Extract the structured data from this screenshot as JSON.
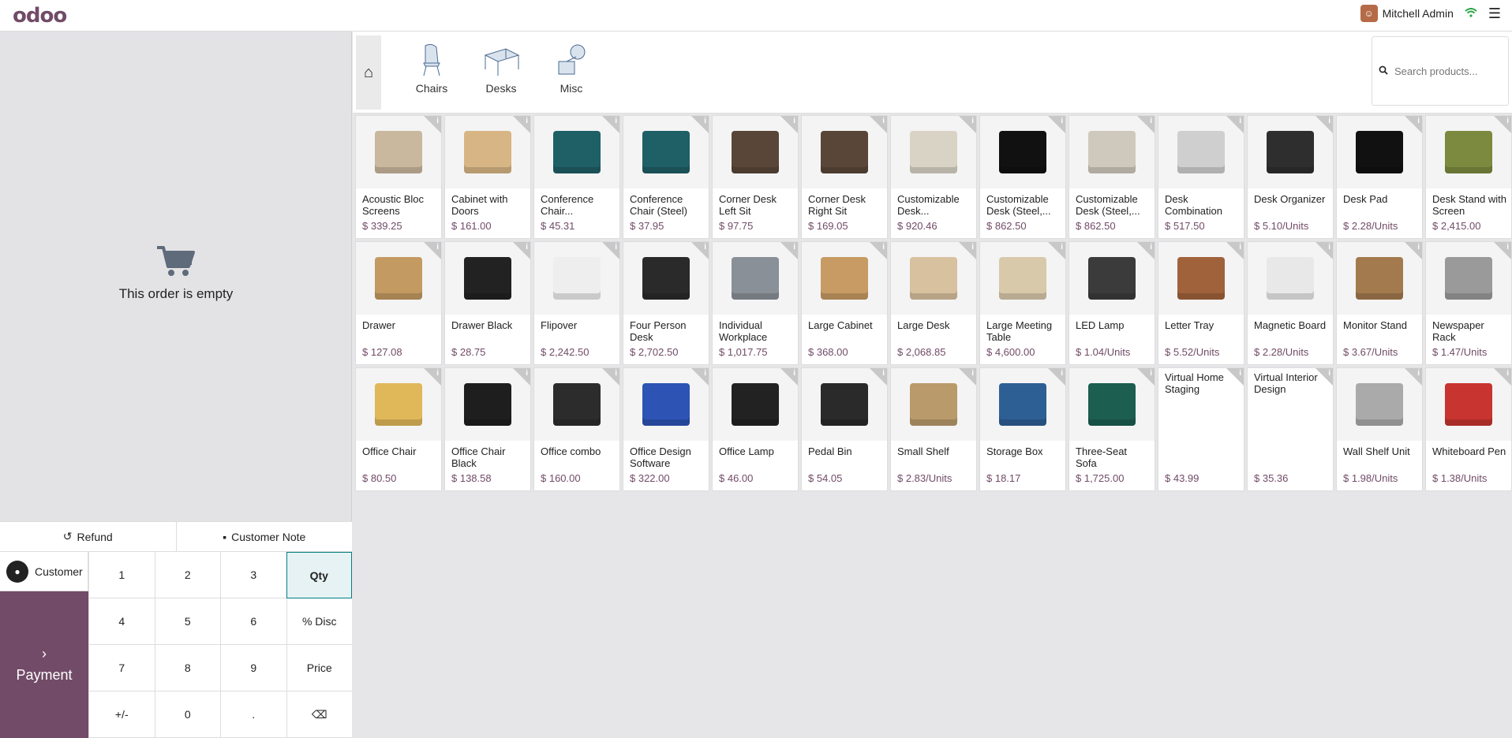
{
  "topbar": {
    "logo": "odoo",
    "user_name": "Mitchell Admin",
    "icons": {
      "wifi": "wifi-icon",
      "menu": "hamburger-menu-icon"
    }
  },
  "order": {
    "empty_text": "This order is empty"
  },
  "actions": {
    "refund": "Refund",
    "customer_note": "Customer Note"
  },
  "pad": {
    "customer": "Customer",
    "payment": "Payment",
    "keys": [
      "1",
      "2",
      "3",
      "Qty",
      "4",
      "5",
      "6",
      "% Disc",
      "7",
      "8",
      "9",
      "Price",
      "+/-",
      "0",
      ".",
      "⌫"
    ]
  },
  "categories": [
    {
      "label": "Chairs",
      "icon": "chair-icon"
    },
    {
      "label": "Desks",
      "icon": "desk-icon"
    },
    {
      "label": "Misc",
      "icon": "misc-icon"
    }
  ],
  "search": {
    "placeholder": "Search products..."
  },
  "products": [
    {
      "name": "Acoustic Bloc Screens",
      "price": "$ 339.25",
      "color": "#c9b79e"
    },
    {
      "name": "Cabinet with Doors",
      "price": "$ 161.00",
      "color": "#d8b584"
    },
    {
      "name": "Conference Chair...",
      "price": "$ 45.31",
      "color": "#1f5f66"
    },
    {
      "name": "Conference Chair (Steel)",
      "price": "$ 37.95",
      "color": "#1f5f66"
    },
    {
      "name": "Corner Desk Left Sit",
      "price": "$ 97.75",
      "color": "#5a4638"
    },
    {
      "name": "Corner Desk Right Sit",
      "price": "$ 169.05",
      "color": "#5a4638"
    },
    {
      "name": "Customizable Desk...",
      "price": "$ 920.46",
      "color": "#d9d3c6"
    },
    {
      "name": "Customizable Desk (Steel,...",
      "price": "$ 862.50",
      "color": "#111111"
    },
    {
      "name": "Customizable Desk (Steel,...",
      "price": "$ 862.50",
      "color": "#cfc9bd"
    },
    {
      "name": "Desk Combination",
      "price": "$ 517.50",
      "color": "#cfcfcf"
    },
    {
      "name": "Desk Organizer",
      "price": "$ 5.10/Units",
      "color": "#2e2e2e"
    },
    {
      "name": "Desk Pad",
      "price": "$ 2.28/Units",
      "color": "#111111"
    },
    {
      "name": "Desk Stand with Screen",
      "price": "$ 2,415.00",
      "color": "#7b8a3e"
    },
    {
      "name": "Drawer",
      "price": "$ 127.08",
      "color": "#c39a62"
    },
    {
      "name": "Drawer Black",
      "price": "$ 28.75",
      "color": "#222222"
    },
    {
      "name": "Flipover",
      "price": "$ 2,242.50",
      "color": "#eeeeee"
    },
    {
      "name": "Four Person Desk",
      "price": "$ 2,702.50",
      "color": "#2a2a2a"
    },
    {
      "name": "Individual Workplace",
      "price": "$ 1,017.75",
      "color": "#8a9097"
    },
    {
      "name": "Large Cabinet",
      "price": "$ 368.00",
      "color": "#c79b63"
    },
    {
      "name": "Large Desk",
      "price": "$ 2,068.85",
      "color": "#d7c19f"
    },
    {
      "name": "Large Meeting Table",
      "price": "$ 4,600.00",
      "color": "#d9c9ab"
    },
    {
      "name": "LED Lamp",
      "price": "$ 1.04/Units",
      "color": "#3b3b3b"
    },
    {
      "name": "Letter Tray",
      "price": "$ 5.52/Units",
      "color": "#a0623a"
    },
    {
      "name": "Magnetic Board",
      "price": "$ 2.28/Units",
      "color": "#e8e8e8"
    },
    {
      "name": "Monitor Stand",
      "price": "$ 3.67/Units",
      "color": "#a37a4e"
    },
    {
      "name": "Newspaper Rack",
      "price": "$ 1.47/Units",
      "color": "#9a9a9a"
    },
    {
      "name": "Office Chair",
      "price": "$ 80.50",
      "color": "#e0b85a"
    },
    {
      "name": "Office Chair Black",
      "price": "$ 138.58",
      "color": "#1e1e1e"
    },
    {
      "name": "Office combo",
      "price": "$ 160.00",
      "color": "#2c2c2c"
    },
    {
      "name": "Office Design Software",
      "price": "$ 322.00",
      "color": "#2d53b5"
    },
    {
      "name": "Office Lamp",
      "price": "$ 46.00",
      "color": "#222222"
    },
    {
      "name": "Pedal Bin",
      "price": "$ 54.05",
      "color": "#2a2a2a"
    },
    {
      "name": "Small Shelf",
      "price": "$ 2.83/Units",
      "color": "#b99a6b"
    },
    {
      "name": "Storage Box",
      "price": "$ 18.17",
      "color": "#2e5f94"
    },
    {
      "name": "Three-Seat Sofa",
      "price": "$ 1,725.00",
      "color": "#1c5e50"
    },
    {
      "name": "Virtual Home Staging",
      "price": "$ 43.99",
      "color": "",
      "noimg": true
    },
    {
      "name": "Virtual Interior Design",
      "price": "$ 35.36",
      "color": "",
      "noimg": true
    },
    {
      "name": "Wall Shelf Unit",
      "price": "$ 1.98/Units",
      "color": "#aaaaaa"
    },
    {
      "name": "Whiteboard Pen",
      "price": "$ 1.38/Units",
      "color": "#c8342f"
    }
  ]
}
